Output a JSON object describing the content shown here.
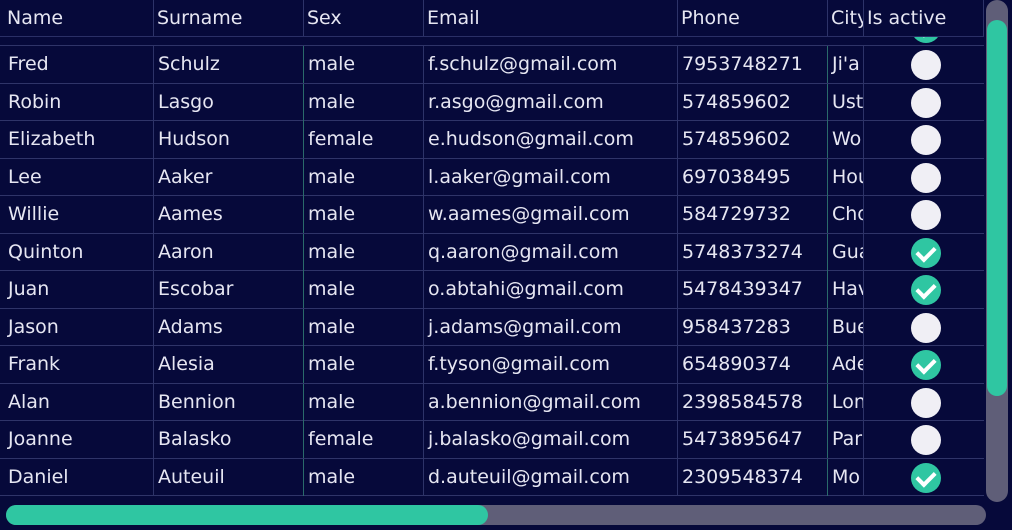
{
  "columns": [
    "Name",
    "Surname",
    "Sex",
    "Email",
    "Phone",
    "City",
    "Is active"
  ],
  "rows": [
    {
      "name": "Fred",
      "surname": "Schulz",
      "sex": "male",
      "email": "f.schulz@gmail.com",
      "phone": "7953748271",
      "city": "Ji'a",
      "active": false
    },
    {
      "name": "Robin",
      "surname": "Lasgo",
      "sex": "male",
      "email": "r.asgo@gmail.com",
      "phone": "574859602",
      "city": "Ust",
      "active": false
    },
    {
      "name": "Elizabeth",
      "surname": "Hudson",
      "sex": "female",
      "email": "e.hudson@gmail.com",
      "phone": "574859602",
      "city": "Wo",
      "active": false
    },
    {
      "name": "Lee",
      "surname": "Aaker",
      "sex": "male",
      "email": "l.aaker@gmail.com",
      "phone": "697038495",
      "city": "Hou",
      "active": false
    },
    {
      "name": "Willie",
      "surname": "Aames",
      "sex": "male",
      "email": "w.aames@gmail.com",
      "phone": "584729732",
      "city": "Cho",
      "active": false
    },
    {
      "name": "Quinton",
      "surname": "Aaron",
      "sex": "male",
      "email": "q.aaron@gmail.com",
      "phone": "5748373274",
      "city": "Gua",
      "active": true
    },
    {
      "name": "Juan",
      "surname": "Escobar",
      "sex": "male",
      "email": "o.abtahi@gmail.com",
      "phone": "5478439347",
      "city": "Hav",
      "active": true
    },
    {
      "name": "Jason",
      "surname": "Adams",
      "sex": "male",
      "email": "j.adams@gmail.com",
      "phone": "958437283",
      "city": "Bue",
      "active": false
    },
    {
      "name": "Frank",
      "surname": "Alesia",
      "sex": "male",
      "email": "f.tyson@gmail.com",
      "phone": "654890374",
      "city": "Ade",
      "active": true
    },
    {
      "name": "Alan",
      "surname": "Bennion",
      "sex": "male",
      "email": "a.bennion@gmail.com",
      "phone": "2398584578",
      "city": "Lon",
      "active": false
    },
    {
      "name": "Joanne",
      "surname": "Balasko",
      "sex": "female",
      "email": "j.balasko@gmail.com",
      "phone": "5473895647",
      "city": "Par",
      "active": false
    },
    {
      "name": "Daniel",
      "surname": "Auteuil",
      "sex": "male",
      "email": "d.auteuil@gmail.com",
      "phone": "2309548374",
      "city": "Mo",
      "active": true
    }
  ],
  "scroll": {
    "vertical_fraction": 0.04,
    "horizontal_fraction": 0.0
  },
  "colors": {
    "background": "#06093a",
    "accent": "#2fc6a2",
    "toggle_off": "#f0eff5",
    "scrollbar_track": "#5f5e78"
  }
}
